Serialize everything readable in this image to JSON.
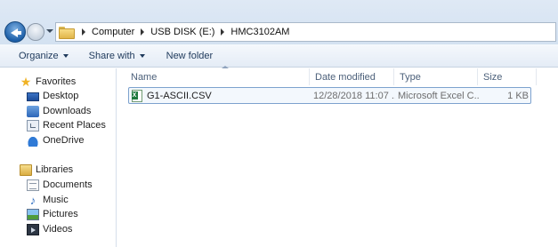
{
  "address_bar": {
    "crumbs": [
      "Computer",
      "USB DISK (E:)",
      "HMC3102AM"
    ]
  },
  "toolbar": {
    "organize_label": "Organize",
    "share_label": "Share with",
    "new_folder_label": "New folder"
  },
  "sidebar": {
    "favorites": {
      "label": "Favorites",
      "items": [
        "Desktop",
        "Downloads",
        "Recent Places",
        "OneDrive"
      ]
    },
    "libraries": {
      "label": "Libraries",
      "items": [
        "Documents",
        "Music",
        "Pictures",
        "Videos"
      ]
    }
  },
  "columns": {
    "name": "Name",
    "date": "Date modified",
    "type": "Type",
    "size": "Size"
  },
  "files": [
    {
      "name": "G1-ASCII.CSV",
      "date": "12/28/2018 11:07 ...",
      "type": "Microsoft Excel C...",
      "size": "1 KB",
      "icon": "excel-csv-icon"
    }
  ],
  "colors": {
    "accent": "#7da2ce",
    "toolbar_text": "#1e395b"
  }
}
